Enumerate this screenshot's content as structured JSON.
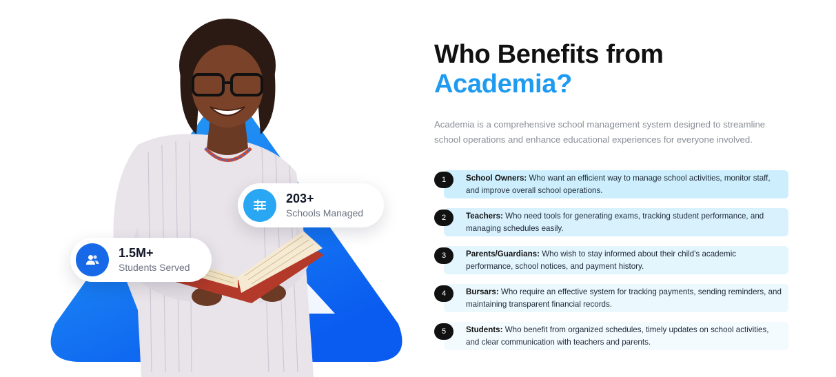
{
  "stats": {
    "schools": {
      "value": "203+",
      "label": "Schools Managed",
      "icon": "sliders-icon"
    },
    "students": {
      "value": "1.5M+",
      "label": "Students Served",
      "icon": "users-icon"
    }
  },
  "heading": {
    "line1": "Who Benefits from",
    "accent": "Academia?"
  },
  "intro": "Academia is a comprehensive school management system designed to streamline school operations and enhance educational experiences for everyone involved.",
  "benefits": [
    {
      "number": "1",
      "title": "School Owners:",
      "text": " Who want an efficient way to manage school activities, monitor staff, and improve overall school operations."
    },
    {
      "number": "2",
      "title": "Teachers:",
      "text": " Who need tools for generating exams, tracking student performance, and managing schedules easily."
    },
    {
      "number": "3",
      "title": "Parents/Guardians:",
      "text": " Who wish to stay informed about their child's academic performance, school notices, and payment history."
    },
    {
      "number": "4",
      "title": "Bursars:",
      "text": " Who require an effective system for tracking payments, sending reminders, and maintaining transparent financial records."
    },
    {
      "number": "5",
      "title": "Students:",
      "text": " Who benefit from organized schedules, timely updates on school activities, and clear communication with teachers and parents."
    }
  ],
  "colors": {
    "accent": "#1e9bf0",
    "triangle_top": "#1e88e5",
    "triangle_bottom": "#0d5ff2",
    "number_badge": "#111111"
  }
}
